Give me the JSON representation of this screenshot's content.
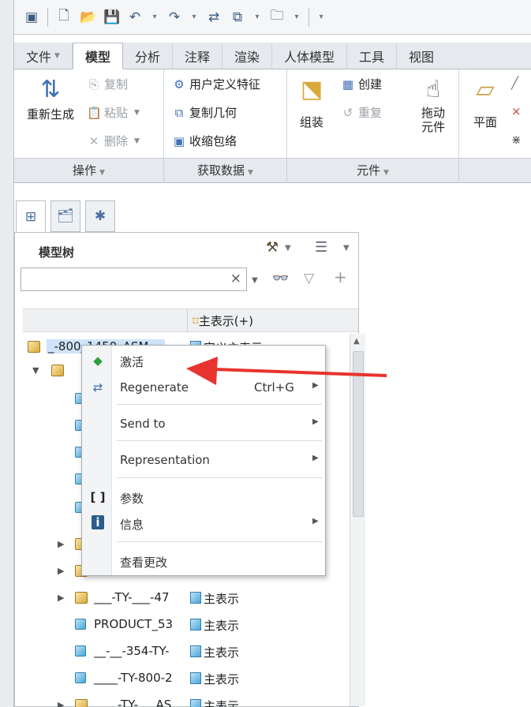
{
  "ribbon": {
    "tabs": [
      "文件",
      "模型",
      "分析",
      "注释",
      "渲染",
      "人体模型",
      "工具",
      "视图"
    ],
    "active_tab": "模型",
    "buttons": {
      "regenerate": "重新生成",
      "copy": "复制",
      "paste": "粘贴",
      "delete": "删除",
      "user_defined_feature": "用户定义特征",
      "copy_geometry": "复制几何",
      "shrinkwrap": "收缩包络",
      "assemble": "组装",
      "create": "创建",
      "repeat": "重复",
      "drag_components": "拖动\n元件",
      "plane": "平面"
    },
    "groups": [
      "操作",
      "获取数据",
      "元件"
    ]
  },
  "navigator": {
    "title": "模型树",
    "search_value": "",
    "column_header": "主表示(+)",
    "root": {
      "name": "_-800_1450_ASM",
      "rep": "定义主表示"
    },
    "rows": [
      {
        "name": "___-TY-___-47",
        "rep": "主表示"
      },
      {
        "name": "PRODUCT_53",
        "rep": "主表示"
      },
      {
        "name": "__-__-354-TY-",
        "rep": "主表示"
      },
      {
        "name": "____-TY-800-2",
        "rep": "主表示"
      },
      {
        "name": "____-TY-___AS",
        "rep": "主表示"
      }
    ]
  },
  "context_menu": {
    "items": [
      {
        "label": "激活"
      },
      {
        "label": "Regenerate",
        "shortcut": "Ctrl+G"
      },
      {
        "label": "Send to"
      },
      {
        "label": "Representation"
      },
      {
        "label": "参数"
      },
      {
        "label": "信息"
      },
      {
        "label": "查看更改"
      }
    ]
  },
  "colors": {
    "annotation_arrow": "#e8332e",
    "selection": "#cfe4fa",
    "accent": "#3f6fb5"
  }
}
